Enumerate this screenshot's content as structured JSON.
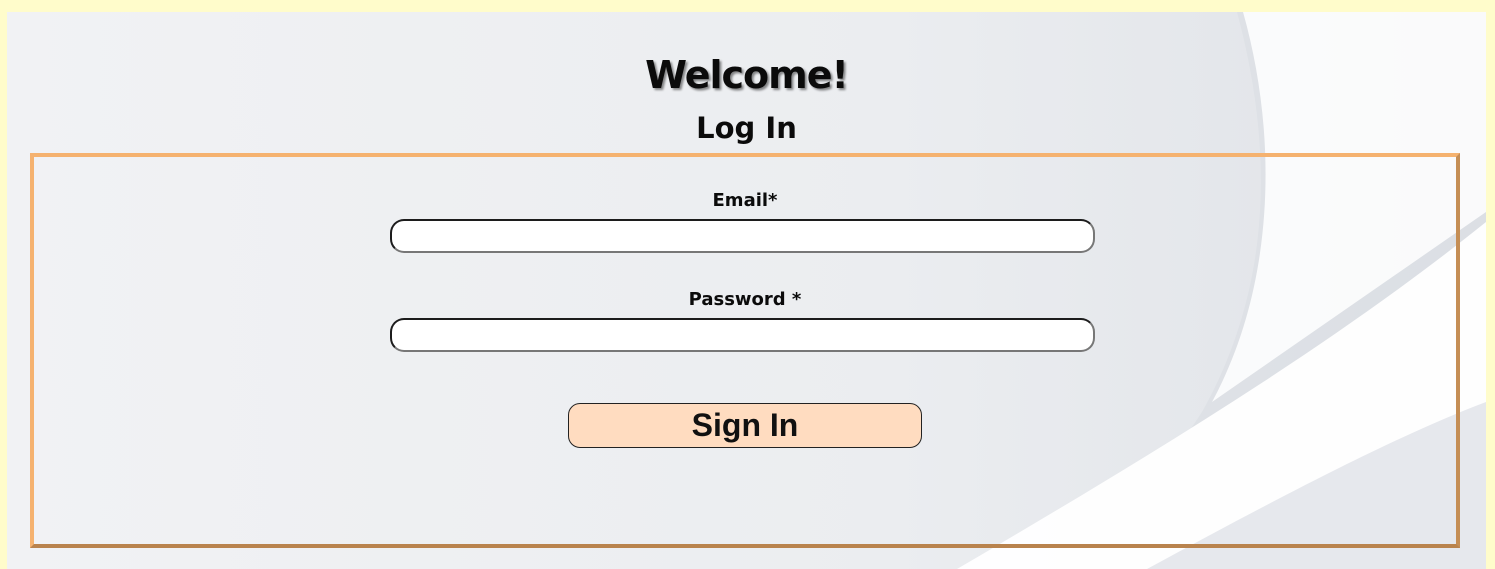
{
  "header": {
    "welcome": "Welcome!",
    "subtitle": "Log In"
  },
  "form": {
    "email_label": "Email*",
    "email_value": "",
    "password_label": "Password *",
    "password_value": "",
    "submit_label": "Sign In"
  },
  "colors": {
    "page_background": "#fffccb",
    "panel_background": "#eef0f3",
    "frame_border": "#f5b26f",
    "button_fill": "#ffdcc0"
  }
}
